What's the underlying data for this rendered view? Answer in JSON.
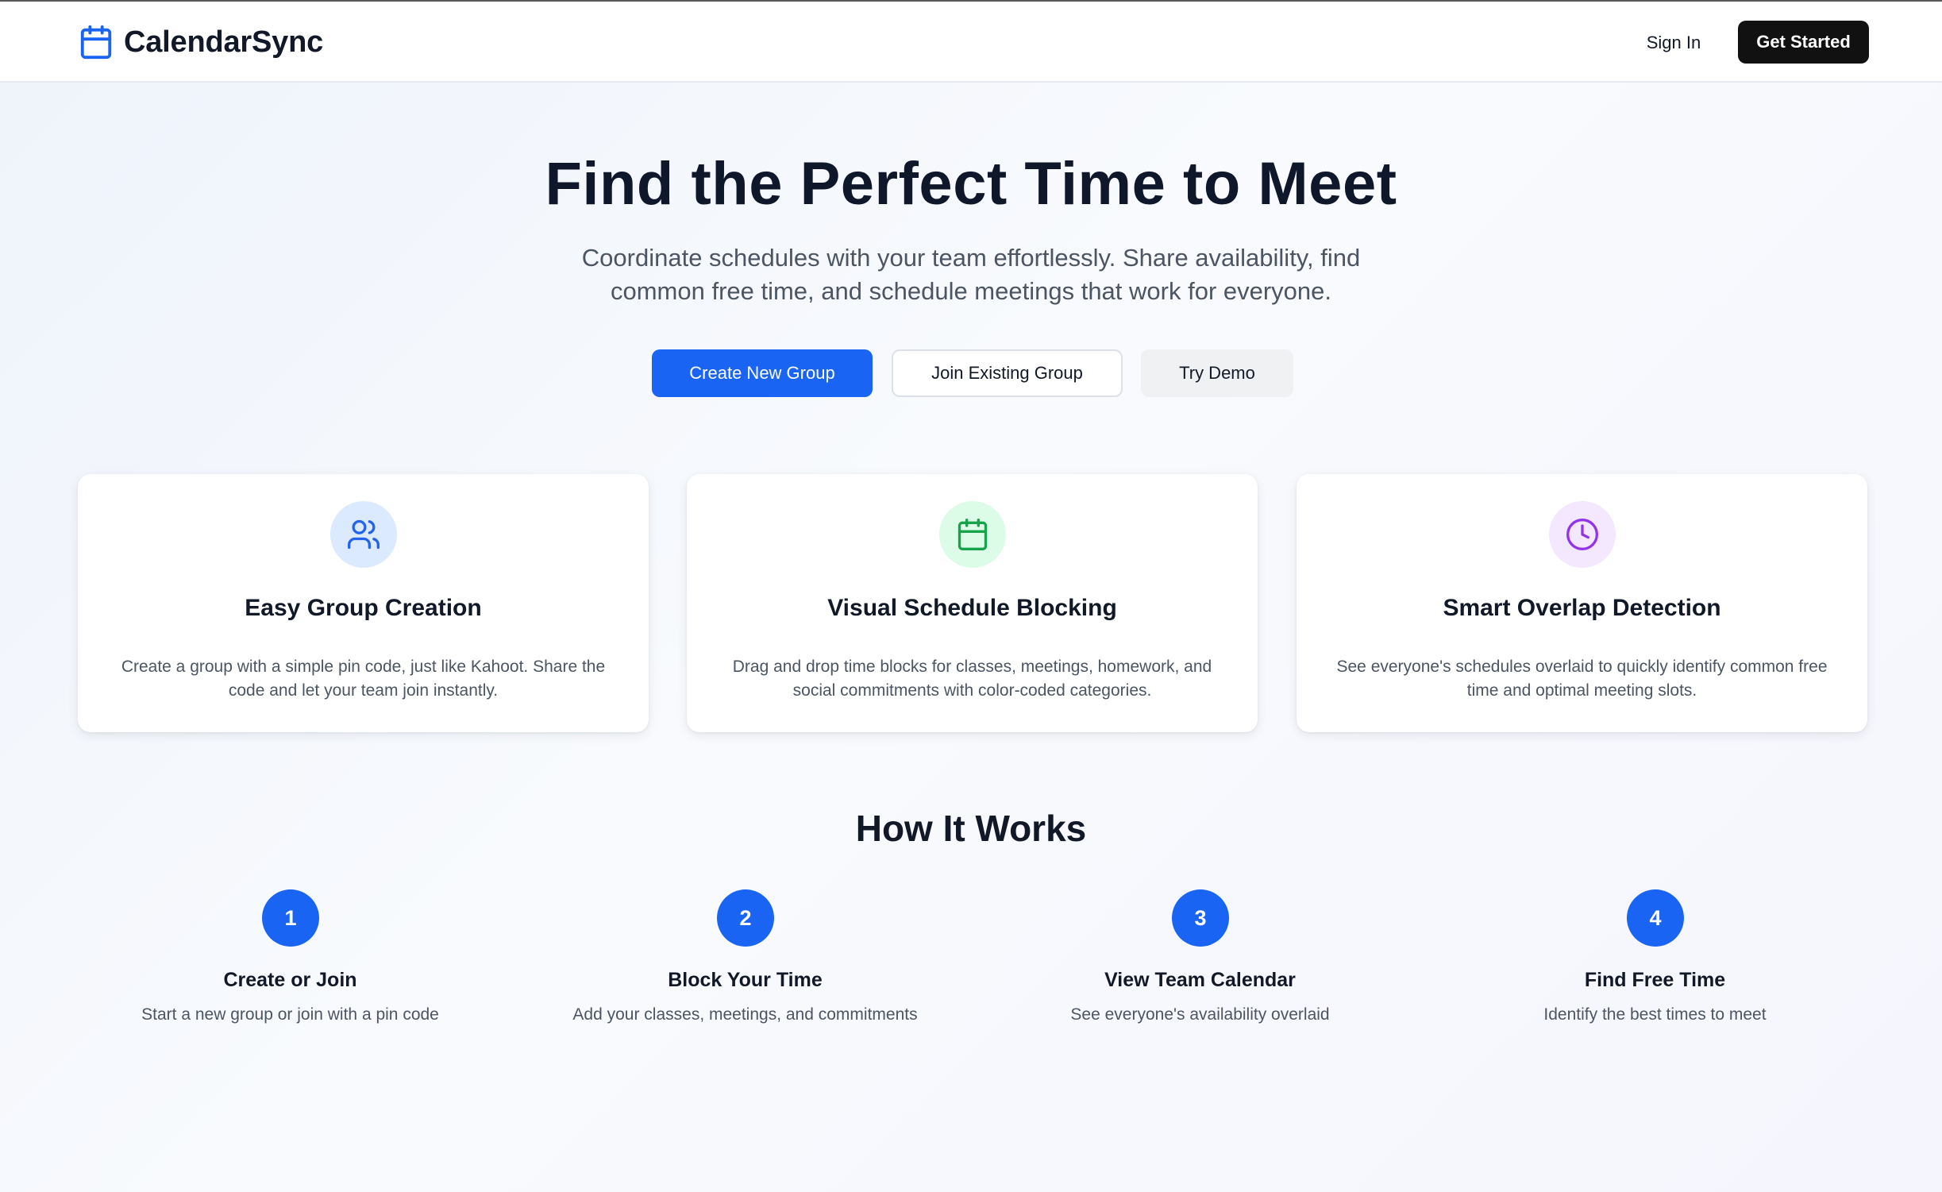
{
  "header": {
    "brand": "CalendarSync",
    "brand_icon": "calendar-icon",
    "sign_in": "Sign In",
    "get_started": "Get Started"
  },
  "hero": {
    "title": "Find the Perfect Time to Meet",
    "subtitle": "Coordinate schedules with your team effortlessly. Share availability, find common free time, and schedule meetings that work for everyone.",
    "buttons": {
      "create": "Create New Group",
      "join": "Join Existing Group",
      "demo": "Try Demo"
    }
  },
  "features": [
    {
      "icon": "users-icon",
      "title": "Easy Group Creation",
      "description": "Create a group with a simple pin code, just like Kahoot. Share the code and let your team join instantly."
    },
    {
      "icon": "calendar-icon",
      "title": "Visual Schedule Blocking",
      "description": "Drag and drop time blocks for classes, meetings, homework, and social commitments with color-coded categories."
    },
    {
      "icon": "clock-icon",
      "title": "Smart Overlap Detection",
      "description": "See everyone's schedules overlaid to quickly identify common free time and optimal meeting slots."
    }
  ],
  "how_it_works": {
    "title": "How It Works",
    "steps": [
      {
        "number": "1",
        "title": "Create or Join",
        "description": "Start a new group or join with a pin code"
      },
      {
        "number": "2",
        "title": "Block Your Time",
        "description": "Add your classes, meetings, and commitments"
      },
      {
        "number": "3",
        "title": "View Team Calendar",
        "description": "See everyone's availability overlaid"
      },
      {
        "number": "4",
        "title": "Find Free Time",
        "description": "Identify the best times to meet"
      }
    ]
  },
  "colors": {
    "primary": "#1a64f4",
    "dark_button": "#111111",
    "feature_blue_bg": "#dbeafe",
    "feature_green_bg": "#dcfce7",
    "feature_purple_bg": "#f3e8ff",
    "feature_blue": "#2563eb",
    "feature_green": "#16a34a",
    "feature_purple": "#9333ea"
  }
}
